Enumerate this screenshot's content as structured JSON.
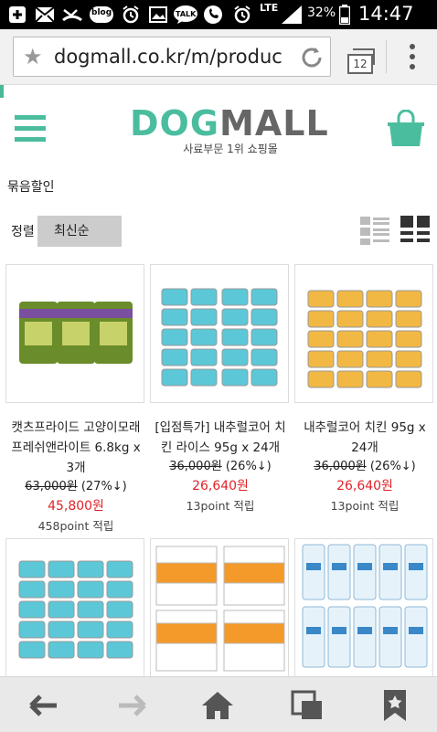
{
  "status_bar": {
    "time": "14:47",
    "battery": "32%",
    "network": "LTE",
    "icons": [
      "add-icon",
      "mail-icon",
      "missed-call-icon",
      "blog-icon",
      "alarm-icon",
      "gallery-icon",
      "talk-icon",
      "phone-icon",
      "alarm-icon",
      "signal-icon",
      "battery-icon"
    ],
    "blog_label": "blog",
    "talk_label": "TALK"
  },
  "browser": {
    "url": "dogmall.co.kr/m/product_l",
    "tab_count": "12"
  },
  "header": {
    "logo_dog": "DOG",
    "logo_mall": "MALL",
    "tagline": "사료부문 1위 쇼핑몰"
  },
  "page": {
    "section_title": "묶음할인",
    "sort_label": "정렬",
    "sort_value": "최신순"
  },
  "products": [
    {
      "name": "캣츠프라이드 고양이모래 프레쉬앤라이트 6.8kg x 3개",
      "original_price": "63,000원",
      "discount": "(27%↓)",
      "sale_price": "45,800원",
      "points": "458point 적립"
    },
    {
      "name": "[입점특가] 내추럴코어 치킨 라이스 95g x 24개",
      "original_price": "36,000원",
      "discount": "(26%↓)",
      "sale_price": "26,640원",
      "points": "13point 적립"
    },
    {
      "name": "내추럴코어 치킨 95g x 24개",
      "original_price": "36,000원",
      "discount": "(26%↓)",
      "sale_price": "26,640원",
      "points": "13point 적립"
    }
  ],
  "colors": {
    "brand_green": "#4bbd9f",
    "logo_gray": "#666666",
    "sale_red": "#e0242b"
  }
}
